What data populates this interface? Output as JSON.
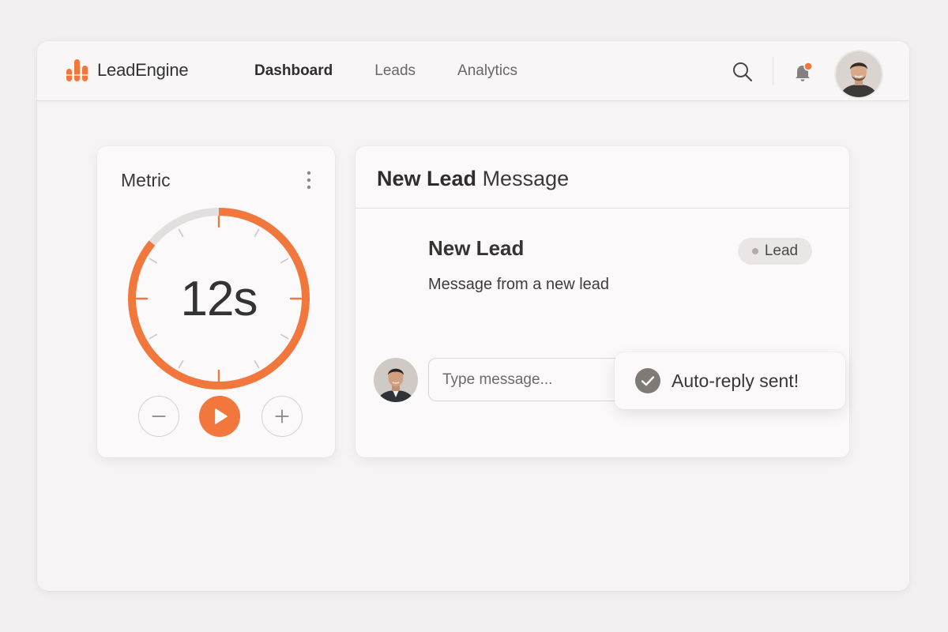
{
  "app": {
    "name": "LeadEngine",
    "brand_color": "#f2773d"
  },
  "nav": {
    "items": [
      {
        "label": "Dashboard",
        "active": true
      },
      {
        "label": "Leads",
        "active": false
      },
      {
        "label": "Analytics",
        "active": false
      }
    ]
  },
  "header_actions": {
    "icons": [
      "search-icon",
      "bell-icon",
      "avatar"
    ],
    "notification_dot_color": "#f2773d"
  },
  "metric": {
    "title": "Metric",
    "value": "12s",
    "progress_fraction": 0.86,
    "controls": [
      "minus-icon",
      "play-icon",
      "plus-icon"
    ]
  },
  "message_card": {
    "header_bold": "New Lead",
    "header_light": "Message",
    "lead_name": "New Lead",
    "lead_subtitle": "Message from a new lead",
    "badge": "Lead",
    "input_placeholder": "Type message..."
  },
  "toast": {
    "text": "Auto-reply sent!",
    "icon": "check-circle-icon"
  }
}
